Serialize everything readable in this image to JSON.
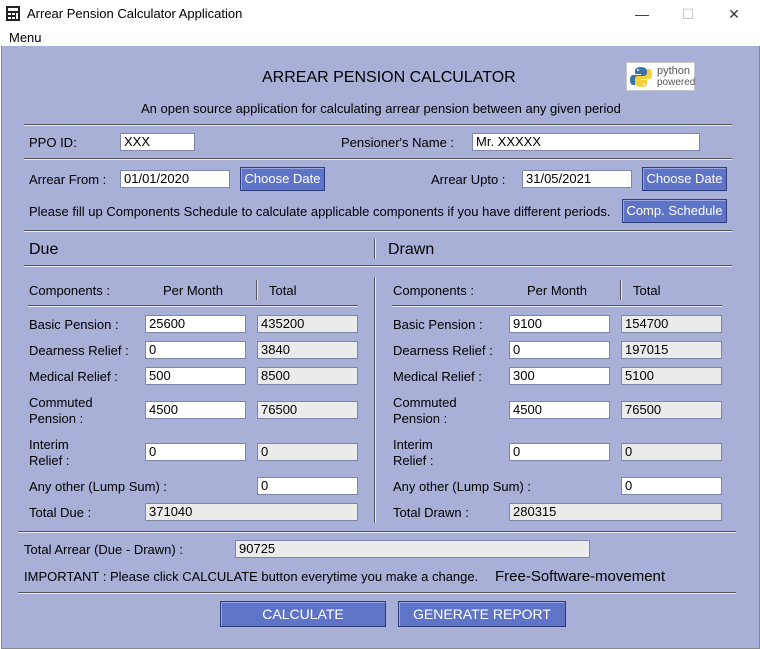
{
  "window": {
    "title": "Arrear Pension Calculator Application",
    "minimize": "—",
    "maximize": "☐",
    "close": "✕"
  },
  "menu": {
    "item": "Menu"
  },
  "header": {
    "title": "ARREAR PENSION CALCULATOR",
    "subtitle": "An open source application for calculating arrear pension between any given period",
    "logo_top": "python",
    "logo_bottom": "powered"
  },
  "pensioner": {
    "ppo_label": "PPO ID:",
    "ppo_value": "XXX",
    "name_label": "Pensioner's Name :",
    "name_value": "Mr. XXXXX"
  },
  "period": {
    "from_label": "Arrear From :",
    "from_value": "01/01/2020",
    "upto_label": "Arrear Upto :",
    "upto_value": "31/05/2021",
    "choose_date": "Choose Date",
    "schedule_note": "Please fill up Components Schedule to calculate applicable components if you have different periods.",
    "schedule_button": "Comp. Schedule"
  },
  "columns": {
    "components": "Components :",
    "per_month": "Per Month",
    "total": "Total"
  },
  "labels": {
    "basic": "Basic Pension :",
    "dearness": "Dearness Relief :",
    "medical": "Medical Relief :",
    "commuted_1": "Commuted",
    "commuted_2": "Pension :",
    "interim_1": "Interim",
    "interim_2": "Relief :",
    "other": "Any other (Lump Sum) :"
  },
  "due": {
    "heading": "Due",
    "basic": {
      "per_month": "25600",
      "total": "435200"
    },
    "dearness": {
      "per_month": "0",
      "total": "3840"
    },
    "medical": {
      "per_month": "500",
      "total": "8500"
    },
    "commuted": {
      "per_month": "4500",
      "total": "76500"
    },
    "interim": {
      "per_month": "0",
      "total": "0"
    },
    "other_total": "0",
    "total_label": "Total Due :",
    "total_value": "371040"
  },
  "drawn": {
    "heading": "Drawn",
    "basic": {
      "per_month": "9100",
      "total": "154700"
    },
    "dearness": {
      "per_month": "0",
      "total": "197015"
    },
    "medical": {
      "per_month": "300",
      "total": "5100"
    },
    "commuted": {
      "per_month": "4500",
      "total": "76500"
    },
    "interim": {
      "per_month": "0",
      "total": "0"
    },
    "other_total": "0",
    "total_label": "Total Drawn :",
    "total_value": "280315"
  },
  "summary": {
    "arrear_label": "Total Arrear (Due - Drawn) :",
    "arrear_value": "90725",
    "important": "IMPORTANT : Please click CALCULATE button everytime you make a change.",
    "tagline": "Free-Software-movement"
  },
  "actions": {
    "calculate": "CALCULATE",
    "report": "GENERATE REPORT"
  }
}
